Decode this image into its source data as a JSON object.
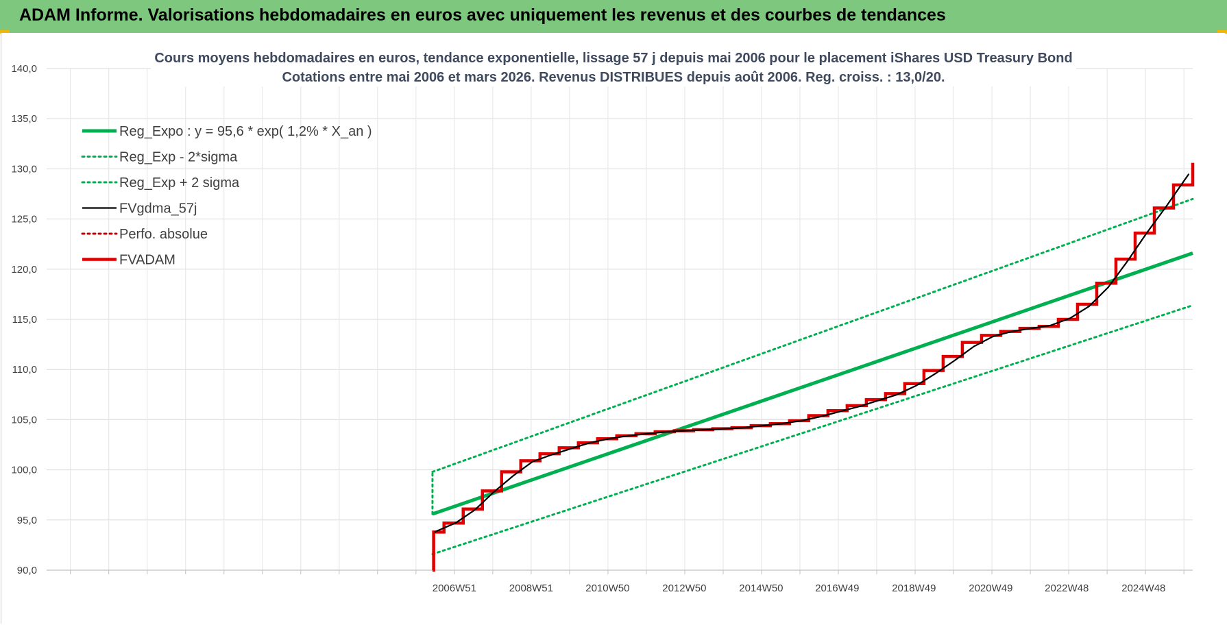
{
  "banner": {
    "title": "ADAM Informe. Valorisations hebdomadaires en euros avec uniquement les revenus et des courbes de tendances"
  },
  "chart_data": {
    "type": "line",
    "title": "Cours moyens hebdomadaires en euros, tendance exponentielle, lissage 57 j depuis mai 2006 pour le placement iShares USD Treasury Bond",
    "subtitle": "Cotations entre mai 2006 et mars 2026. Revenus DISTRIBUES depuis août 2006. Reg. croiss. : 13,0/20.",
    "xlabel": "",
    "ylabel": "",
    "ylim": [
      90,
      140
    ],
    "yticks": [
      "90,0",
      "95,0",
      "100,0",
      "105,0",
      "110,0",
      "115,0",
      "120,0",
      "125,0",
      "130,0",
      "135,0",
      "140,0"
    ],
    "xlim": [
      1996.35,
      2026.2
    ],
    "xticks": [
      {
        "label": "2006W51",
        "x": 2006.97
      },
      {
        "label": "2008W51",
        "x": 2008.97
      },
      {
        "label": "2010W50",
        "x": 2010.96
      },
      {
        "label": "2012W50",
        "x": 2012.96
      },
      {
        "label": "2014W50",
        "x": 2014.96
      },
      {
        "label": "2016W49",
        "x": 2016.94
      },
      {
        "label": "2018W49",
        "x": 2018.94
      },
      {
        "label": "2020W49",
        "x": 2020.94
      },
      {
        "label": "2022W48",
        "x": 2022.92
      },
      {
        "label": "2024W48",
        "x": 2024.92
      }
    ],
    "grid": true,
    "legend_position": "top-left",
    "series": [
      {
        "name": "Reg_Expo : y = 95,6 * exp( 1,2% *  X_an )",
        "color": "#00b050",
        "style": "solid-thick",
        "x": [
          2006.4,
          2026.2
        ],
        "y": [
          95.6,
          121.6
        ]
      },
      {
        "name": "Reg_Exp - 2*sigma",
        "color": "#00b050",
        "style": "dotted",
        "x": [
          2006.4,
          2026.2
        ],
        "y": [
          91.6,
          116.4
        ]
      },
      {
        "name": "Reg_Exp + 2 sigma",
        "color": "#00b050",
        "style": "dotted",
        "x": [
          2006.4,
          2026.2
        ],
        "y": [
          99.8,
          127.0
        ]
      },
      {
        "name": "FVgdma_57j",
        "color": "#000000",
        "style": "solid-thin",
        "x": [
          2006.45,
          2007.0,
          2007.5,
          2008.0,
          2008.5,
          2009.0,
          2009.5,
          2010.0,
          2010.5,
          2011.0,
          2011.5,
          2012.0,
          2012.5,
          2013.0,
          2013.5,
          2014.0,
          2014.5,
          2015.0,
          2015.5,
          2016.0,
          2016.5,
          2017.0,
          2017.5,
          2018.0,
          2018.5,
          2019.0,
          2019.5,
          2020.0,
          2020.5,
          2021.0,
          2021.5,
          2022.0,
          2022.5,
          2023.0,
          2023.5,
          2024.0,
          2024.5,
          2025.0,
          2025.5,
          2026.1
        ],
        "y": [
          93.8,
          94.7,
          96.0,
          97.8,
          99.4,
          100.8,
          101.5,
          102.1,
          102.7,
          103.1,
          103.4,
          103.6,
          103.8,
          103.9,
          104.0,
          104.1,
          104.2,
          104.4,
          104.6,
          104.9,
          105.3,
          105.8,
          106.3,
          106.9,
          107.5,
          108.4,
          109.6,
          110.9,
          112.3,
          113.3,
          113.8,
          114.1,
          114.4,
          115.1,
          116.3,
          118.2,
          120.8,
          123.6,
          126.2,
          129.5
        ]
      },
      {
        "name": "Perfo. absolue",
        "color": "#c00000",
        "style": "dotted",
        "x": [],
        "y": []
      },
      {
        "name": "FVADAM",
        "color": "#e00000",
        "style": "solid-thick-step",
        "x": [
          2006.4,
          2006.43,
          2006.7,
          2007.2,
          2007.7,
          2008.2,
          2008.7,
          2009.2,
          2009.7,
          2010.2,
          2010.7,
          2011.2,
          2011.7,
          2012.2,
          2012.7,
          2013.2,
          2013.7,
          2014.2,
          2014.7,
          2015.2,
          2015.7,
          2016.2,
          2016.7,
          2017.2,
          2017.7,
          2018.2,
          2018.7,
          2019.2,
          2019.7,
          2020.2,
          2020.7,
          2021.2,
          2021.7,
          2022.2,
          2022.7,
          2023.2,
          2023.7,
          2024.2,
          2024.7,
          2025.2,
          2025.7,
          2026.2
        ],
        "y": [
          90.0,
          93.8,
          94.7,
          96.1,
          97.9,
          99.8,
          100.9,
          101.6,
          102.2,
          102.7,
          103.1,
          103.4,
          103.6,
          103.8,
          103.9,
          104.0,
          104.1,
          104.2,
          104.4,
          104.6,
          104.9,
          105.4,
          105.9,
          106.4,
          107.0,
          107.6,
          108.6,
          109.9,
          111.3,
          112.7,
          113.4,
          113.8,
          114.1,
          114.3,
          115.0,
          116.5,
          118.6,
          121.0,
          123.6,
          126.1,
          128.4,
          130.6
        ]
      }
    ]
  }
}
